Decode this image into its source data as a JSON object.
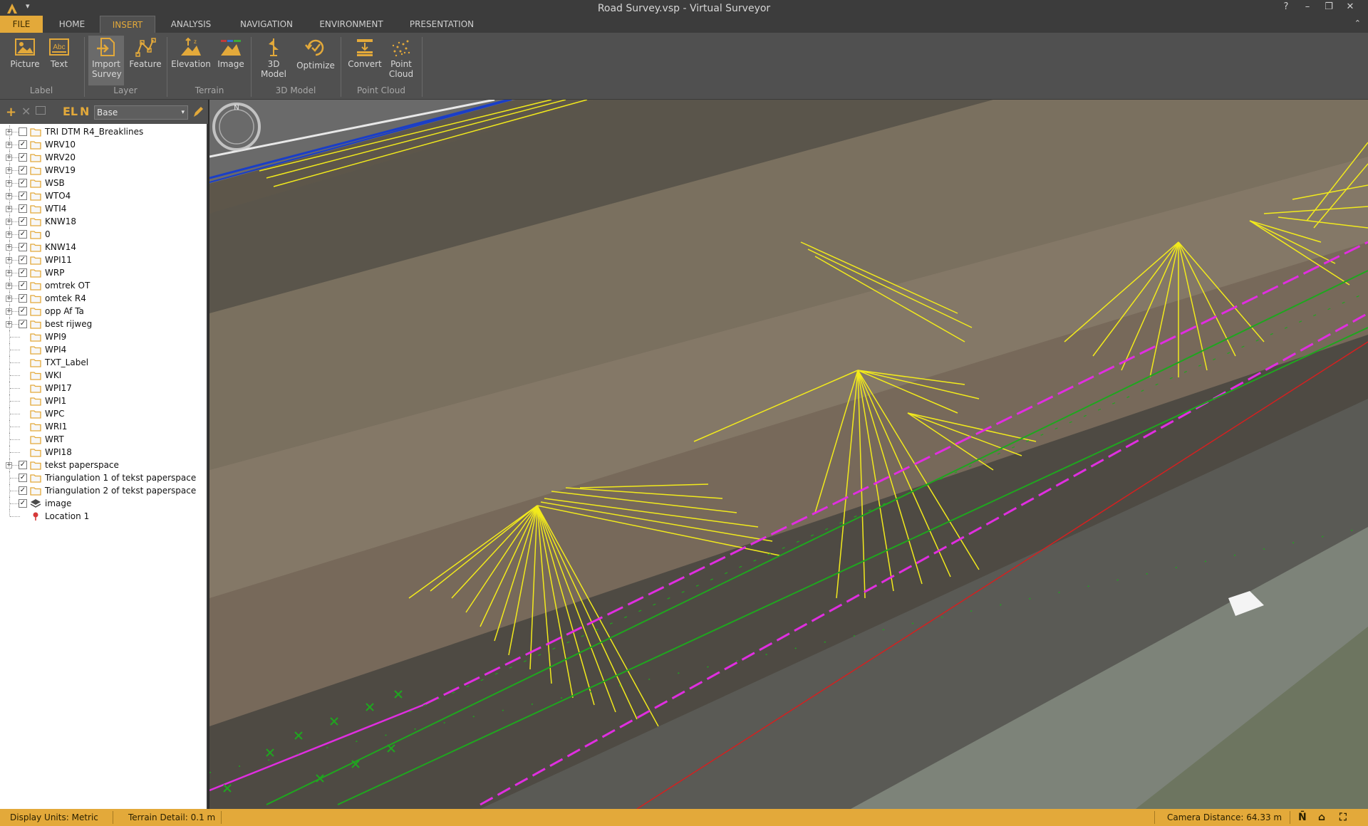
{
  "window": {
    "title": "Road Survey.vsp  -  Virtual Surveyor",
    "help": "?",
    "minimize": "–",
    "restore": "❐",
    "close": "✕",
    "qa_caret": "▾"
  },
  "menu": {
    "tabs": [
      "FILE",
      "HOME",
      "INSERT",
      "ANALYSIS",
      "NAVIGATION",
      "ENVIRONMENT",
      "PRESENTATION"
    ],
    "active": "INSERT"
  },
  "ribbon": {
    "buttons": [
      "Picture",
      "Text",
      "Import Survey",
      "Feature",
      "Elevation",
      "Image",
      "3D Model",
      "Optimize",
      "Convert",
      "Point Cloud"
    ],
    "groups": [
      "Label",
      "Layer",
      "Terrain",
      "3D Model",
      "Point Cloud"
    ]
  },
  "layer_panel": {
    "toolbar": {
      "add": "+",
      "remove": "✕",
      "el": "EL",
      "n": "N"
    },
    "selected_layer": "Base",
    "items": [
      {
        "label": "TRI DTM R4_Breaklines",
        "checked": false,
        "expandable": true,
        "icon": "folder"
      },
      {
        "label": "WRV10",
        "checked": true,
        "expandable": true,
        "icon": "folder"
      },
      {
        "label": "WRV20",
        "checked": true,
        "expandable": true,
        "icon": "folder"
      },
      {
        "label": "WRV19",
        "checked": true,
        "expandable": true,
        "icon": "folder"
      },
      {
        "label": "WSB",
        "checked": true,
        "expandable": true,
        "icon": "folder"
      },
      {
        "label": "WTO4",
        "checked": true,
        "expandable": true,
        "icon": "folder"
      },
      {
        "label": "WTI4",
        "checked": true,
        "expandable": true,
        "icon": "folder"
      },
      {
        "label": "KNW18",
        "checked": true,
        "expandable": true,
        "icon": "folder"
      },
      {
        "label": "0",
        "checked": true,
        "expandable": true,
        "icon": "folder"
      },
      {
        "label": "KNW14",
        "checked": true,
        "expandable": true,
        "icon": "folder"
      },
      {
        "label": "WPI11",
        "checked": true,
        "expandable": true,
        "icon": "folder"
      },
      {
        "label": "WRP",
        "checked": true,
        "expandable": true,
        "icon": "folder"
      },
      {
        "label": "omtrek OT",
        "checked": true,
        "expandable": true,
        "icon": "folder"
      },
      {
        "label": "omtek R4",
        "checked": true,
        "expandable": true,
        "icon": "folder"
      },
      {
        "label": "opp Af Ta",
        "checked": true,
        "expandable": true,
        "icon": "folder"
      },
      {
        "label": "best rijweg",
        "checked": true,
        "expandable": true,
        "icon": "folder"
      },
      {
        "label": "WPI9",
        "checked": null,
        "expandable": false,
        "icon": "folder"
      },
      {
        "label": "WPI4",
        "checked": null,
        "expandable": false,
        "icon": "folder"
      },
      {
        "label": "TXT_Label",
        "checked": null,
        "expandable": false,
        "icon": "folder"
      },
      {
        "label": "WKI",
        "checked": null,
        "expandable": false,
        "icon": "folder"
      },
      {
        "label": "WPI17",
        "checked": null,
        "expandable": false,
        "icon": "folder"
      },
      {
        "label": "WPI1",
        "checked": null,
        "expandable": false,
        "icon": "folder"
      },
      {
        "label": "WPC",
        "checked": null,
        "expandable": false,
        "icon": "folder"
      },
      {
        "label": "WRI1",
        "checked": null,
        "expandable": false,
        "icon": "folder"
      },
      {
        "label": "WRT",
        "checked": null,
        "expandable": false,
        "icon": "folder"
      },
      {
        "label": "WPI18",
        "checked": null,
        "expandable": false,
        "icon": "folder"
      },
      {
        "label": "tekst paperspace",
        "checked": true,
        "expandable": true,
        "icon": "folder"
      },
      {
        "label": "Triangulation 1 of tekst paperspace",
        "checked": true,
        "expandable": false,
        "icon": "folder"
      },
      {
        "label": "Triangulation 2 of tekst paperspace",
        "checked": true,
        "expandable": false,
        "icon": "folder"
      },
      {
        "label": "image",
        "checked": true,
        "expandable": false,
        "icon": "layers"
      },
      {
        "label": "Location 1",
        "checked": null,
        "expandable": false,
        "icon": "pin"
      }
    ]
  },
  "status": {
    "display_units": "Display Units:  Metric",
    "terrain_detail": "Terrain Detail: 0.1 m",
    "camera_distance": "Camera Distance: 64.33 m",
    "north_icon": "N̄",
    "home_icon": "⌂",
    "extent_icon": "⛶"
  },
  "colors": {
    "accent": "#e3a93a",
    "ribbon_bg": "#505050",
    "yellow_lines": "#f2ea1c",
    "green_lines": "#1fa61f",
    "magenta_lines": "#e02ee0",
    "red_line": "#d42020",
    "blue_line": "#1a3ec8"
  }
}
